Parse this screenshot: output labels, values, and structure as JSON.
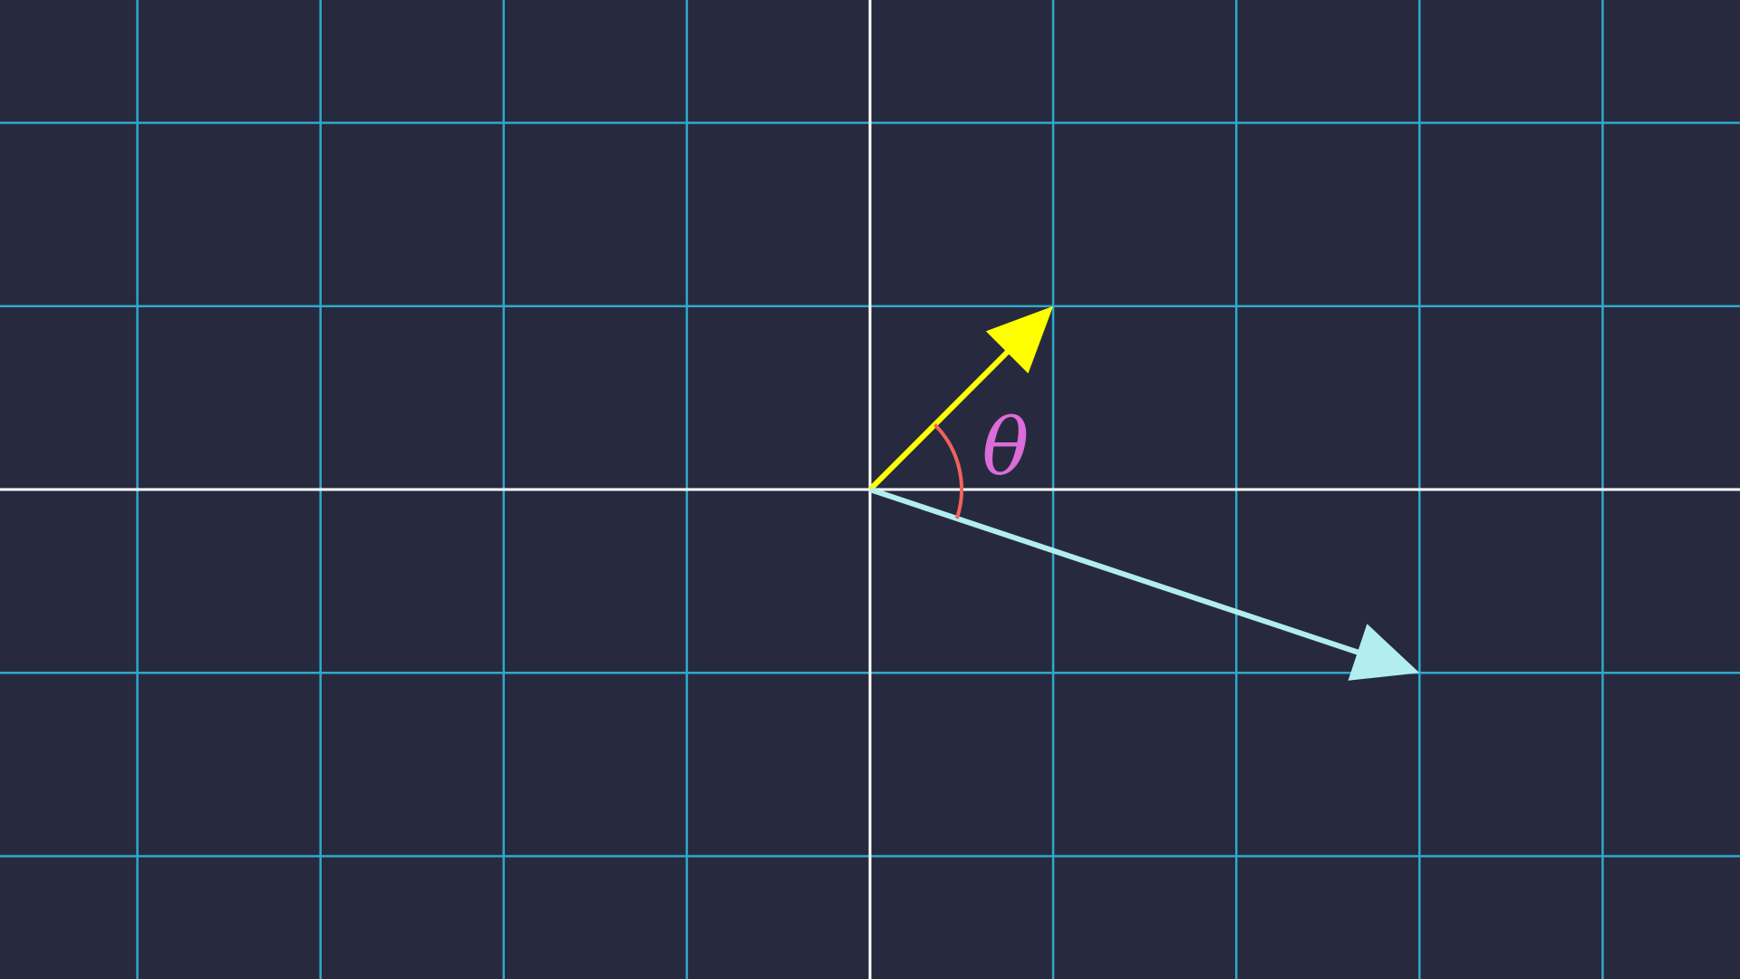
{
  "colors": {
    "background": "#272a3f",
    "grid": "#2fa9c9",
    "axis": "#ffffff",
    "vector_a": "#ffff00",
    "vector_b": "#b2eef0",
    "angle_arc": "#f0635a",
    "angle_label": "#db6cd9"
  },
  "plane": {
    "x_range": [
      -4.75,
      4.75
    ],
    "y_range": [
      -2.67,
      2.67
    ],
    "grid_step": 1
  },
  "vectors": [
    {
      "name": "vector-a",
      "x": 1,
      "y": 1,
      "color_key": "vector_a"
    },
    {
      "name": "vector-b",
      "x": 3,
      "y": -1,
      "color_key": "vector_b"
    }
  ],
  "angle": {
    "label": "θ",
    "arc_radius": 0.5
  }
}
